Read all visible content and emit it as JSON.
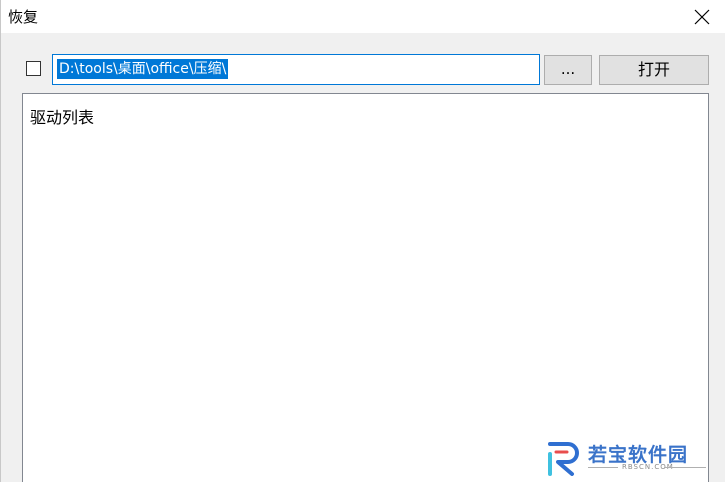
{
  "window": {
    "title": "恢复"
  },
  "toolbar": {
    "path_value": "D:\\tools\\桌面\\office\\压缩\\",
    "browse_label": "...",
    "open_label": "打开"
  },
  "drive_list": {
    "header": "驱动列表"
  },
  "watermark": {
    "brand": "若宝软件园",
    "domain": "RBSCN.COM"
  },
  "colors": {
    "accent": "#0078d7",
    "watermark": "#3a73c9"
  }
}
